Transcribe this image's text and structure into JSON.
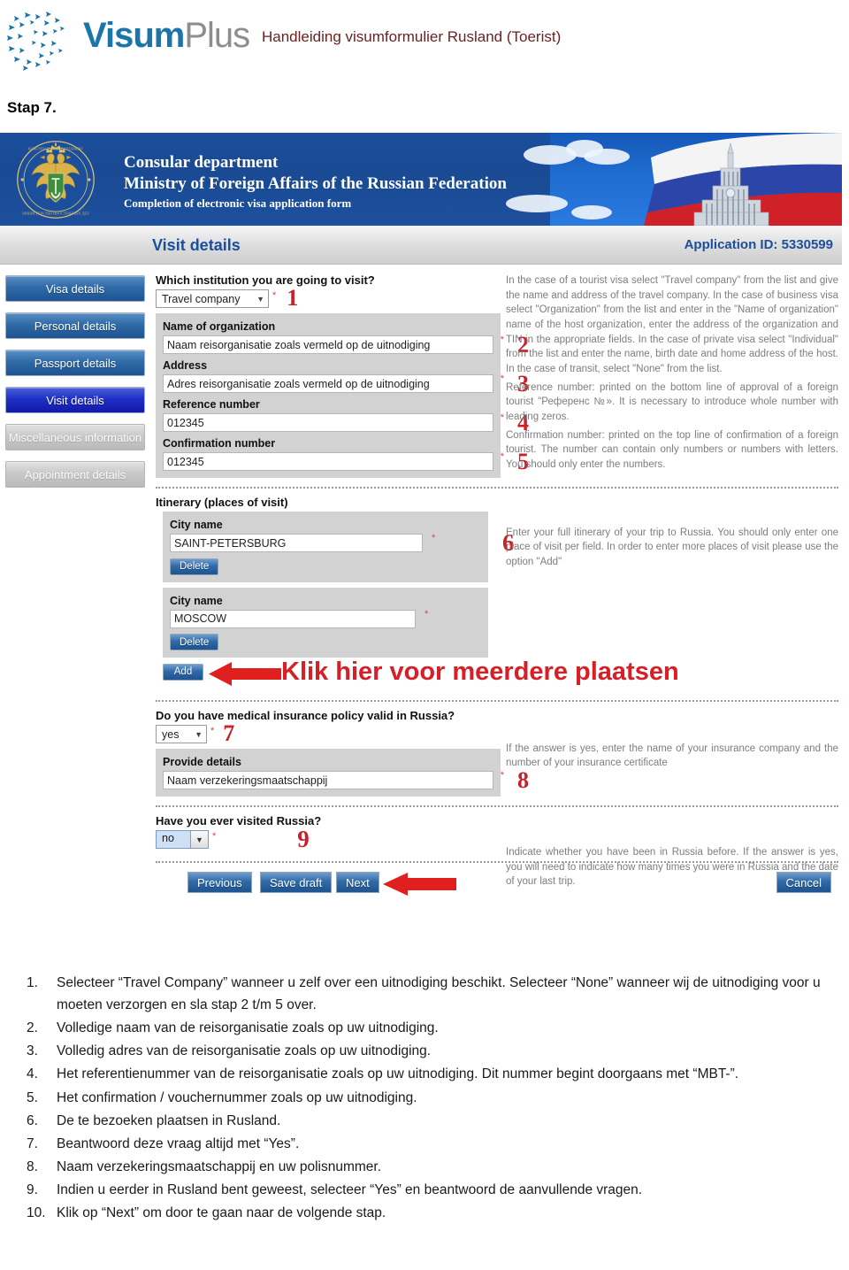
{
  "header": {
    "logo_visum": "Visum",
    "logo_plus": "Plus",
    "title": "Handleiding visumformulier Rusland (Toerist)"
  },
  "step_heading": "Stap 7.",
  "screenshot": {
    "banner": {
      "line1": "Consular department",
      "line2": "Ministry of Foreign Affairs of the Russian Federation",
      "line3": "Completion of electronic visa application form"
    },
    "titlebar": {
      "section": "Visit details",
      "application_id": "Application ID: 5330599"
    },
    "sidebar": {
      "items": [
        {
          "label": "Visa details",
          "state": "enabled"
        },
        {
          "label": "Personal details",
          "state": "enabled"
        },
        {
          "label": "Passport details",
          "state": "enabled"
        },
        {
          "label": "Visit details",
          "state": "active"
        },
        {
          "label": "Miscellaneous information",
          "state": "disabled"
        },
        {
          "label": "Appointment details",
          "state": "disabled"
        }
      ]
    },
    "form": {
      "institution_question": "Which institution you are going to visit?",
      "institution_value": "Travel company",
      "institution_marker": "1",
      "organization_label": "Name of organization",
      "organization_value": "Naam reisorganisatie zoals vermeld op de uitnodiging",
      "organization_marker": "2",
      "address_label": "Address",
      "address_value": "Adres reisorganisatie zoals vermeld op de uitnodiging",
      "address_marker": "3",
      "reference_label": "Reference number",
      "reference_value": "012345",
      "reference_marker": "4",
      "confirmation_label": "Confirmation number",
      "confirmation_value": "012345",
      "confirmation_marker": "5",
      "itinerary_label": "Itinerary (places of visit)",
      "itinerary_marker": "6",
      "city_label": "City name",
      "city_1_value": "SAINT-PETERSBURG",
      "city_2_value": "MOSCOW",
      "delete_label": "Delete",
      "add_label": "Add",
      "annotation_add": "Klik hier voor meerdere plaatsen",
      "insurance_question": "Do you have medical insurance policy valid in Russia?",
      "insurance_value": "yes",
      "insurance_marker": "7",
      "provide_details_label": "Provide details",
      "provide_details_value": "Naam verzekeringsmaatschappij",
      "provide_details_marker": "8",
      "visited_question": "Have you ever visited Russia?",
      "visited_value": "no",
      "visited_marker": "9",
      "required_star": "*"
    },
    "help": {
      "block1": "In the case of a tourist visa select \"Travel company\" from the list and give the name and address of the travel company. In the case of business visa select \"Organization\" from the list and enter in the \"Name of organization\" name of the host organization, enter the address of the organization and TIN in the appropriate fields. In the case of private visa select \"Individual\" from the list and enter the name, birth date and home address of the host. In the case of transit, select \"None\" from the list.",
      "block2": "Reference number: printed on the bottom line of approval of a foreign tourist \"Референс №». It is necessary to introduce whole number with leading zeros.",
      "block3": "Confirmation number: printed on the top line of confirmation of a foreign tourist. The number can contain only numbers or numbers with letters. You should only enter the numbers.",
      "block4": "Enter your full itinerary of your trip to Russia. You should only enter one place of visit per field. In order to enter more places of visit please use the option \"Add\"",
      "block5": "If the answer is yes, enter the name of your insurance company and the number of your insurance certificate",
      "block6": "Indicate whether you have been in Russia before. If the answer is yes, you will need to indicate how many times you were in Russia and the date of your last trip."
    },
    "footer_buttons": {
      "previous": "Previous",
      "save_draft": "Save draft",
      "next": "Next",
      "cancel": "Cancel"
    }
  },
  "instructions": [
    {
      "num": "1.",
      "text": "Selecteer “Travel Company” wanneer u zelf over een uitnodiging beschikt. Selecteer “None” wanneer wij de uitnodiging voor u moeten verzorgen en sla stap 2 t/m 5 over."
    },
    {
      "num": "2.",
      "text": "Volledige naam van de reisorganisatie zoals op uw uitnodiging."
    },
    {
      "num": "3.",
      "text": "Volledig adres van de reisorganisatie zoals op uw uitnodiging."
    },
    {
      "num": "4.",
      "text": "Het referentienummer van de reisorganisatie zoals op uw uitnodiging. Dit nummer begint doorgaans met “MBT-”."
    },
    {
      "num": "5.",
      "text": "Het confirmation / vouchernummer zoals op uw uitnodiging."
    },
    {
      "num": "6.",
      "text": "De te bezoeken plaatsen in Rusland."
    },
    {
      "num": "7.",
      "text": "Beantwoord deze vraag altijd met “Yes”."
    },
    {
      "num": "8.",
      "text": "Naam verzekeringsmaatschappij en uw polisnummer."
    },
    {
      "num": "9.",
      "text": "Indien u eerder in Rusland bent geweest, selecteer “Yes” en beantwoord de aanvullende vragen."
    },
    {
      "num": "10.",
      "text": "Klik op “Next” om door te gaan naar de volgende stap."
    }
  ],
  "colors": {
    "brand_blue": "#1a75a8",
    "brand_grey": "#8d8d8d",
    "title_maroon": "#6b1f20",
    "banner_blue": "#1b4f9c",
    "accent_red": "#c9202a",
    "annotation_red": "#d61f26"
  }
}
